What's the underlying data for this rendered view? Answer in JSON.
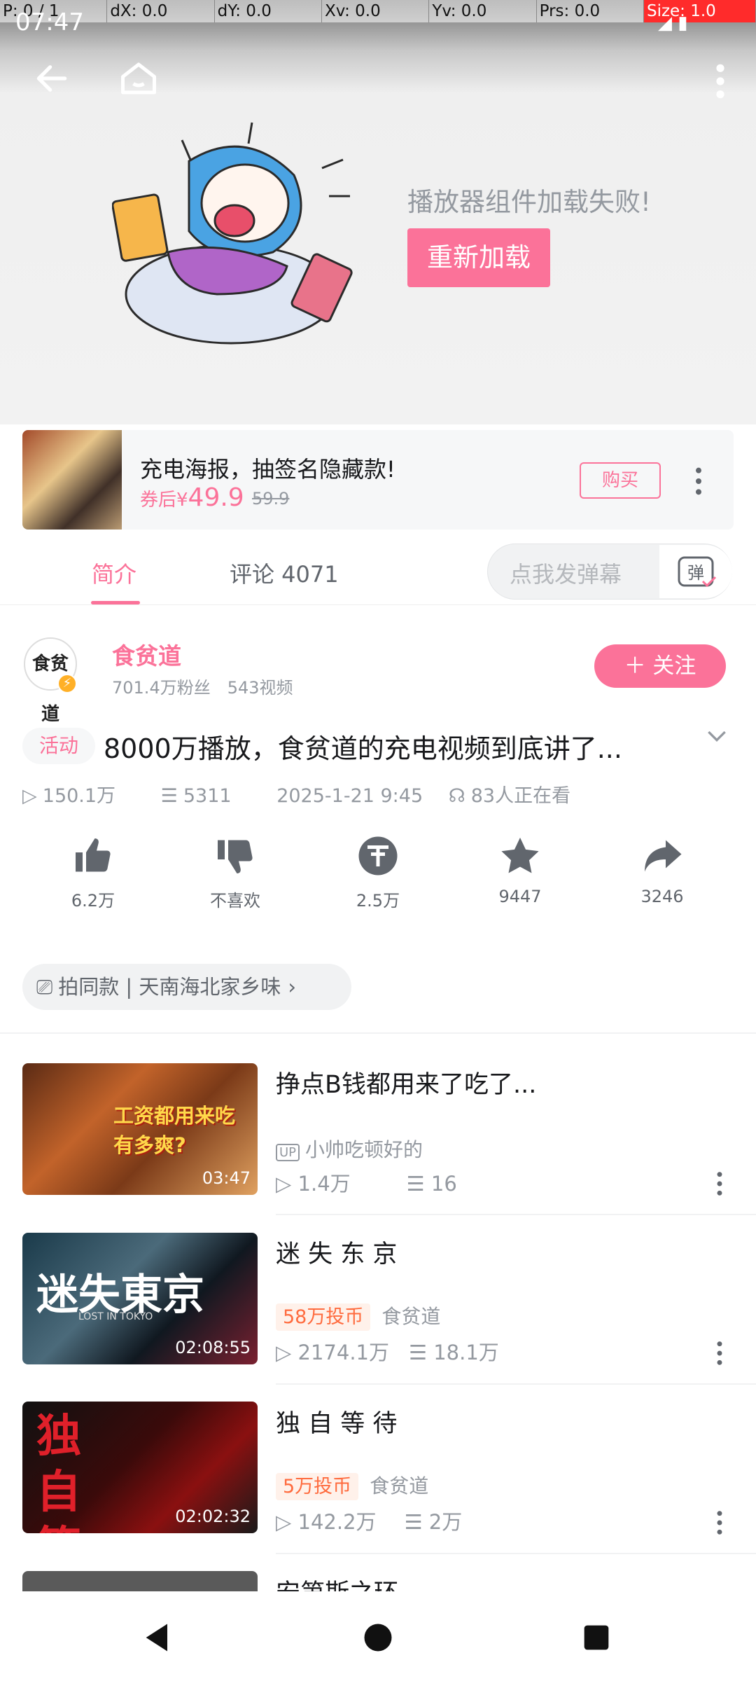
{
  "debug": {
    "items": [
      "P: 0 / 1",
      "dX: 0.0",
      "dY: 0.0",
      "Xv: 0.0",
      "Yv: 0.0",
      "Prs: 0.0",
      "Size: 1.0"
    ]
  },
  "status": {
    "time": "07:47"
  },
  "player": {
    "error_text": "播放器组件加载失败!",
    "reload_label": "重新加载"
  },
  "ad": {
    "title": "充电海报，抽签名隐藏款!",
    "price_prefix": "券后¥",
    "price": "49.9",
    "old_price": "59.9",
    "buy_label": "购买"
  },
  "tabs": [
    {
      "label": "简介"
    },
    {
      "label": "评论 4071"
    }
  ],
  "danmu": {
    "placeholder": "点我发弹幕",
    "button": "弹"
  },
  "uploader": {
    "avatar_text": "食贫道",
    "name": "食贫道",
    "stats": "701.4万粉丝　543视频",
    "follow_label": "＋ 关注"
  },
  "video": {
    "tag": "活动",
    "title": "8000万播放，食贫道的充电视频到底讲了...",
    "plays": "150.1万",
    "danmaku": "5311",
    "date": "2025-1-21 9:45",
    "watching": "83人正在看"
  },
  "actions": [
    {
      "icon": "like-icon",
      "label": "6.2万"
    },
    {
      "icon": "dislike-icon",
      "label": "不喜欢"
    },
    {
      "icon": "coin-icon",
      "label": "2.5万"
    },
    {
      "icon": "star-icon",
      "label": "9447"
    },
    {
      "icon": "share-icon",
      "label": "3246"
    }
  ],
  "same_style": {
    "label": "拍同款 | 天南海北家乡味"
  },
  "related": [
    {
      "title": "挣点B钱都用来了吃了...",
      "thumb_text": "工资都用来吃 有多爽?",
      "duration": "03:47",
      "up_badge": "UP",
      "uploader": "小帅吃顿好的",
      "plays": "1.4万",
      "danmaku": "16"
    },
    {
      "title": "迷 失 东 京",
      "thumb_text": "迷失東京",
      "thumb_sub": "LOST IN TOKYO",
      "duration": "02:08:55",
      "coin_badge": "58万投币",
      "uploader": "食贫道",
      "plays": "2174.1万",
      "danmaku": "18.1万"
    },
    {
      "title": "独 自 等 待",
      "thumb_text": "独自等待",
      "duration": "02:02:32",
      "coin_badge": "5万投币",
      "uploader": "食贫道",
      "plays": "142.2万",
      "danmaku": "2万"
    },
    {
      "title": "安第斯之环"
    }
  ],
  "colors": {
    "accent": "#fb7299",
    "text": "#18191c",
    "muted": "#9499a0",
    "coin_badge": "#ff6b3e"
  }
}
